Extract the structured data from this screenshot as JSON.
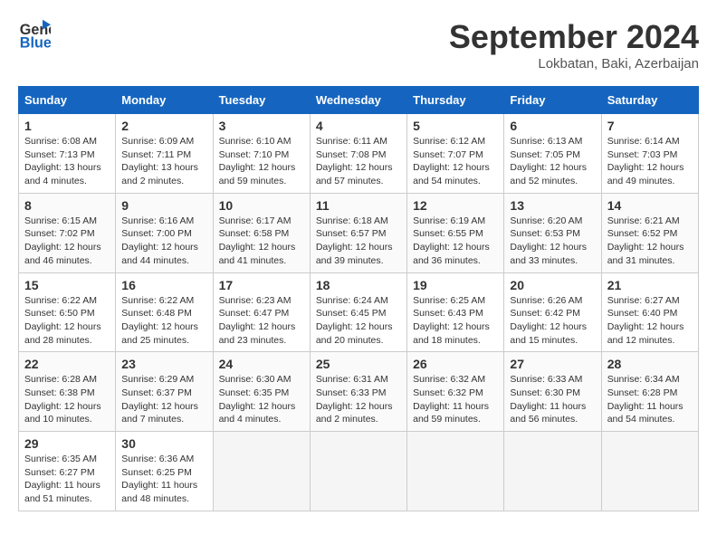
{
  "header": {
    "logo_line1": "General",
    "logo_line2": "Blue",
    "month": "September 2024",
    "location": "Lokbatan, Baki, Azerbaijan"
  },
  "weekdays": [
    "Sunday",
    "Monday",
    "Tuesday",
    "Wednesday",
    "Thursday",
    "Friday",
    "Saturday"
  ],
  "weeks": [
    [
      {
        "day": "1",
        "sunrise": "6:08 AM",
        "sunset": "7:13 PM",
        "daylight": "13 hours and 4 minutes."
      },
      {
        "day": "2",
        "sunrise": "6:09 AM",
        "sunset": "7:11 PM",
        "daylight": "13 hours and 2 minutes."
      },
      {
        "day": "3",
        "sunrise": "6:10 AM",
        "sunset": "7:10 PM",
        "daylight": "12 hours and 59 minutes."
      },
      {
        "day": "4",
        "sunrise": "6:11 AM",
        "sunset": "7:08 PM",
        "daylight": "12 hours and 57 minutes."
      },
      {
        "day": "5",
        "sunrise": "6:12 AM",
        "sunset": "7:07 PM",
        "daylight": "12 hours and 54 minutes."
      },
      {
        "day": "6",
        "sunrise": "6:13 AM",
        "sunset": "7:05 PM",
        "daylight": "12 hours and 52 minutes."
      },
      {
        "day": "7",
        "sunrise": "6:14 AM",
        "sunset": "7:03 PM",
        "daylight": "12 hours and 49 minutes."
      }
    ],
    [
      {
        "day": "8",
        "sunrise": "6:15 AM",
        "sunset": "7:02 PM",
        "daylight": "12 hours and 46 minutes."
      },
      {
        "day": "9",
        "sunrise": "6:16 AM",
        "sunset": "7:00 PM",
        "daylight": "12 hours and 44 minutes."
      },
      {
        "day": "10",
        "sunrise": "6:17 AM",
        "sunset": "6:58 PM",
        "daylight": "12 hours and 41 minutes."
      },
      {
        "day": "11",
        "sunrise": "6:18 AM",
        "sunset": "6:57 PM",
        "daylight": "12 hours and 39 minutes."
      },
      {
        "day": "12",
        "sunrise": "6:19 AM",
        "sunset": "6:55 PM",
        "daylight": "12 hours and 36 minutes."
      },
      {
        "day": "13",
        "sunrise": "6:20 AM",
        "sunset": "6:53 PM",
        "daylight": "12 hours and 33 minutes."
      },
      {
        "day": "14",
        "sunrise": "6:21 AM",
        "sunset": "6:52 PM",
        "daylight": "12 hours and 31 minutes."
      }
    ],
    [
      {
        "day": "15",
        "sunrise": "6:22 AM",
        "sunset": "6:50 PM",
        "daylight": "12 hours and 28 minutes."
      },
      {
        "day": "16",
        "sunrise": "6:22 AM",
        "sunset": "6:48 PM",
        "daylight": "12 hours and 25 minutes."
      },
      {
        "day": "17",
        "sunrise": "6:23 AM",
        "sunset": "6:47 PM",
        "daylight": "12 hours and 23 minutes."
      },
      {
        "day": "18",
        "sunrise": "6:24 AM",
        "sunset": "6:45 PM",
        "daylight": "12 hours and 20 minutes."
      },
      {
        "day": "19",
        "sunrise": "6:25 AM",
        "sunset": "6:43 PM",
        "daylight": "12 hours and 18 minutes."
      },
      {
        "day": "20",
        "sunrise": "6:26 AM",
        "sunset": "6:42 PM",
        "daylight": "12 hours and 15 minutes."
      },
      {
        "day": "21",
        "sunrise": "6:27 AM",
        "sunset": "6:40 PM",
        "daylight": "12 hours and 12 minutes."
      }
    ],
    [
      {
        "day": "22",
        "sunrise": "6:28 AM",
        "sunset": "6:38 PM",
        "daylight": "12 hours and 10 minutes."
      },
      {
        "day": "23",
        "sunrise": "6:29 AM",
        "sunset": "6:37 PM",
        "daylight": "12 hours and 7 minutes."
      },
      {
        "day": "24",
        "sunrise": "6:30 AM",
        "sunset": "6:35 PM",
        "daylight": "12 hours and 4 minutes."
      },
      {
        "day": "25",
        "sunrise": "6:31 AM",
        "sunset": "6:33 PM",
        "daylight": "12 hours and 2 minutes."
      },
      {
        "day": "26",
        "sunrise": "6:32 AM",
        "sunset": "6:32 PM",
        "daylight": "11 hours and 59 minutes."
      },
      {
        "day": "27",
        "sunrise": "6:33 AM",
        "sunset": "6:30 PM",
        "daylight": "11 hours and 56 minutes."
      },
      {
        "day": "28",
        "sunrise": "6:34 AM",
        "sunset": "6:28 PM",
        "daylight": "11 hours and 54 minutes."
      }
    ],
    [
      {
        "day": "29",
        "sunrise": "6:35 AM",
        "sunset": "6:27 PM",
        "daylight": "11 hours and 51 minutes."
      },
      {
        "day": "30",
        "sunrise": "6:36 AM",
        "sunset": "6:25 PM",
        "daylight": "11 hours and 48 minutes."
      },
      null,
      null,
      null,
      null,
      null
    ]
  ]
}
